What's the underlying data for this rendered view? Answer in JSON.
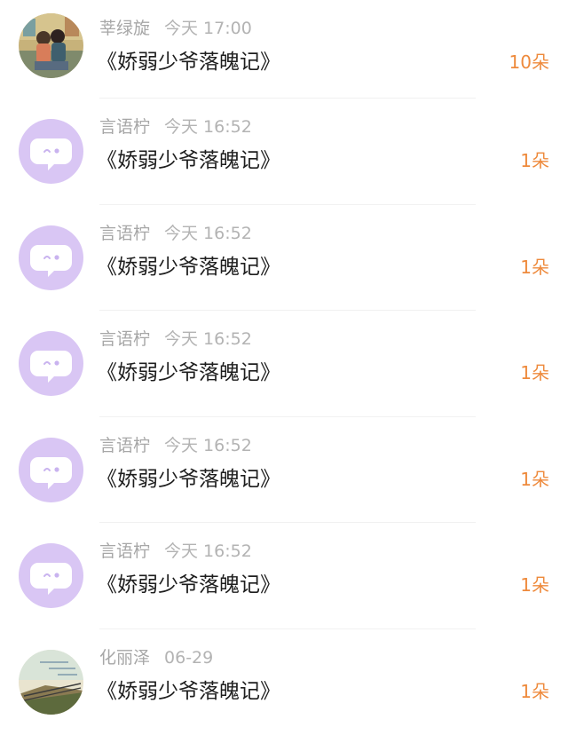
{
  "messages": [
    {
      "avatar": "photo-couple",
      "name": "莘绿旋",
      "time": "今天 17:00",
      "title": "《娇弱少爷落魄记》",
      "count": "10朵"
    },
    {
      "avatar": "default-chat",
      "name": "言语柠",
      "time": "今天 16:52",
      "title": "《娇弱少爷落魄记》",
      "count": "1朵"
    },
    {
      "avatar": "default-chat",
      "name": "言语柠",
      "time": "今天 16:52",
      "title": "《娇弱少爷落魄记》",
      "count": "1朵"
    },
    {
      "avatar": "default-chat",
      "name": "言语柠",
      "time": "今天 16:52",
      "title": "《娇弱少爷落魄记》",
      "count": "1朵"
    },
    {
      "avatar": "default-chat",
      "name": "言语柠",
      "time": "今天 16:52",
      "title": "《娇弱少爷落魄记》",
      "count": "1朵"
    },
    {
      "avatar": "default-chat",
      "name": "言语柠",
      "time": "今天 16:52",
      "title": "《娇弱少爷落魄记》",
      "count": "1朵"
    },
    {
      "avatar": "photo-landscape",
      "name": "化丽泽",
      "time": "06-29",
      "title": "《娇弱少爷落魄记》",
      "count": "1朵"
    }
  ],
  "colors": {
    "count": "#ee8a3c",
    "avatar_default_bg": "#d9c6f4",
    "name": "#a7a7a7",
    "title": "#1e1e1e"
  }
}
